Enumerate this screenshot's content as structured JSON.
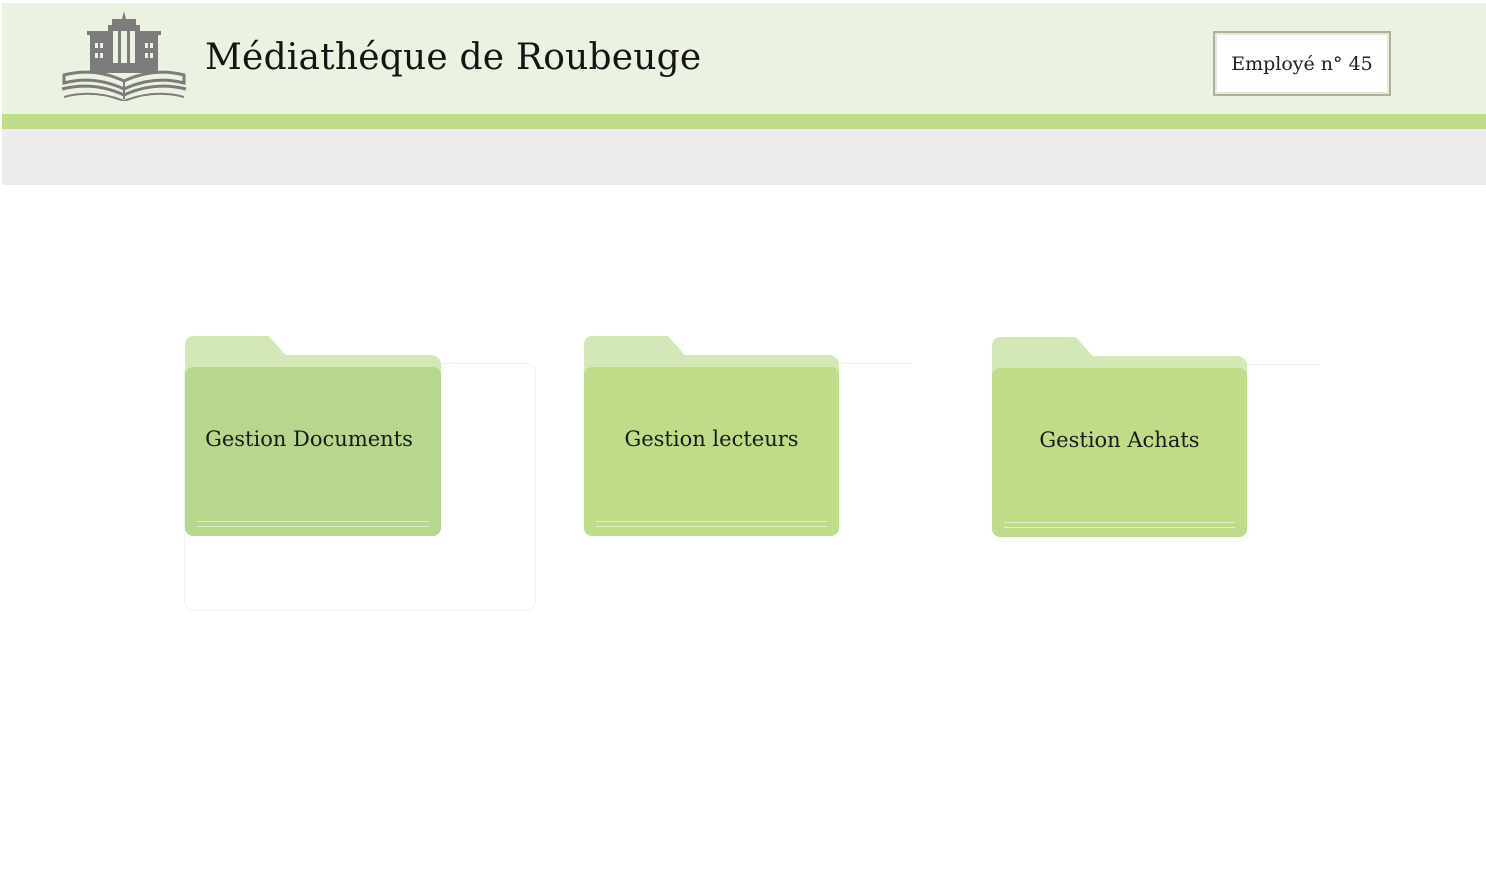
{
  "header": {
    "title": "Médiathéque de Roubeuge",
    "logo_icon": "library-building-book-icon",
    "employee_label": "Employé n° 45"
  },
  "colors": {
    "header_background": "#ebf2e1",
    "accent_bar": "#bedc8a",
    "sub_bar": "#ececec",
    "folder_documents": "#b8d78e",
    "folder_lecteurs": "#bfdc88",
    "folder_achats": "#bfdc88",
    "folder_tab": "#d3e8b6",
    "logo_gray": "#7c7c7c"
  },
  "folders": [
    {
      "label": "Gestion Documents",
      "icon": "folder-icon"
    },
    {
      "label": "Gestion lecteurs",
      "icon": "folder-icon"
    },
    {
      "label": "Gestion Achats",
      "icon": "folder-icon"
    }
  ]
}
